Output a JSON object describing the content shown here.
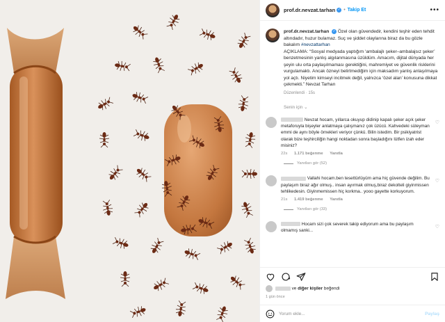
{
  "post": {
    "username": "prof.dr.nevzat.tarhan",
    "follow_label": "Takip Et",
    "caption_before_hashtag": "Özel olan güvendedir, kendini teşhir eden tehdit altındadır, huzur bulamaz. Suç ve şiddet olaylarına biraz da bu gözle bakalım",
    "hashtag": "#nevzattarhan",
    "caption_explanation": "AÇIKLAMA: “Sosyal medyada yaptığım ‘ambalajlı şeker–ambalajsız şeker’ benzetmesinin yanlış algılanmasına üzüldüm. Amacım, dijital dünyada her şeyin ulu orta paylaşılmaması gerektiğini, mahremiyet ve güvenlik risklerini vurgulamaktı. Ancak özneyi belirtmediğim için maksadım yanlış anlaşılmaya yol açtı. Niyetim kimseyi incitmek değil, yalnızca ‘özel alan’ konusuna dikkat çekmekti.” Nevzat Tarhan",
    "edited": "Düzenlendi",
    "edited_age": "15s"
  },
  "comments_sort": "Senin için",
  "comments": [
    {
      "text": "Nevzat hocam, yıllarca okuyup didinip kapalı şeker açık şeker metaforuyla bişeyler anlatmaya çalışmanız çok üzücü. Kahvedeki süleyman emmi de aynı böyle örnekleri veriyor çünkü. Bilin istedim. Bir psikiyatrist olarak bize teşhirciliğin hangi noktadan sonra başladığını lütfen izah eder misiniz?",
      "age": "22s",
      "likes": "1.171 beğenme",
      "reply": "Yanıtla",
      "view_replies": "Yanıtları gör (52)"
    },
    {
      "text": "Vallahi hocam.ben tesettürlüyüm ama hiç güvende değilim. Bu paylaşım biraz ağır olmuş.. insan ayırmak olmuş,biraz dekolteli giyinmissen tehlikedesin. Giyinmemissen hiç korkma.. yooo gayette korkuyorum.",
      "age": "21s",
      "likes": "1.419 beğenme",
      "reply": "Yanıtla",
      "view_replies": "Yanıtları gör (33)"
    },
    {
      "text": "Hocam sizi çok severek takip ediyorum ama bu paylaşım olmamış sanki..."
    }
  ],
  "likes_line": {
    "connector": "ve",
    "others": "diğer kişiler",
    "verb": "beğendi"
  },
  "posted_ago": "1 gün önce",
  "add_comment": {
    "placeholder": "Yorum ekle...",
    "post_label": "Paylaş"
  },
  "colors": {
    "link_blue": "#0095f6",
    "muted": "#8e8e8e",
    "hashtag": "#00376b",
    "photo_bg": "#f1eeea",
    "candy": "#c57a42"
  },
  "icons": [
    "more-options-icon",
    "heart-icon",
    "comment-icon",
    "share-icon",
    "bookmark-icon",
    "emoji-icon",
    "verified-badge-icon"
  ]
}
